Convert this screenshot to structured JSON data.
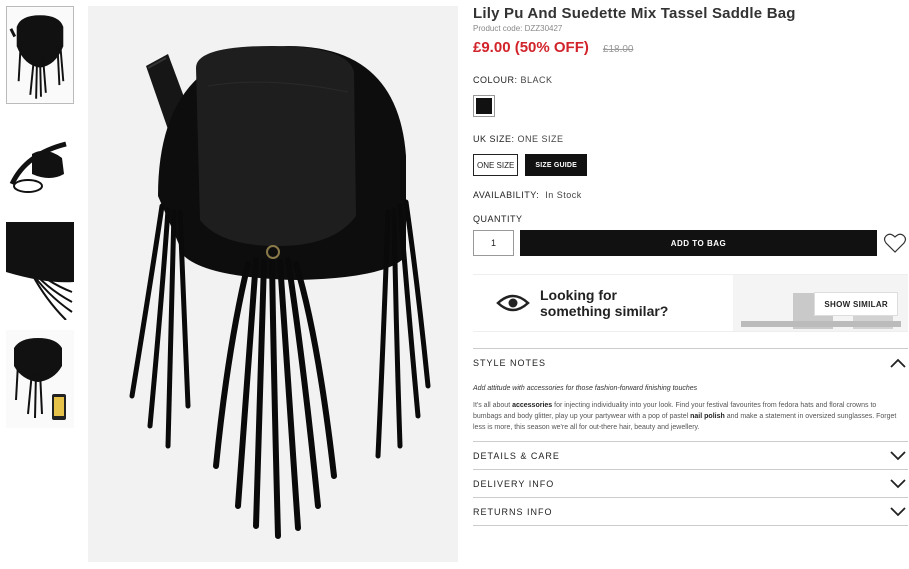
{
  "product": {
    "title": "Lily Pu And Suedette Mix Tassel Saddle Bag",
    "code": "Product code: DZZ30427",
    "price": "£9.00 (50% OFF)",
    "was_price": "£18.00"
  },
  "colour": {
    "label": "COLOUR:",
    "value": "BLACK",
    "swatch_color": "#111111"
  },
  "size": {
    "label": "UK SIZE:",
    "value": "ONE SIZE",
    "option": "ONE SIZE",
    "guide": "SIZE GUIDE"
  },
  "availability": {
    "label": "AVAILABILITY:",
    "value": "In Stock"
  },
  "quantity": {
    "label": "QUANTITY",
    "value": "1"
  },
  "cart": {
    "add_label": "ADD TO BAG"
  },
  "similar": {
    "line1": "Looking for",
    "line2": "something similar?",
    "button": "SHOW SIMILAR"
  },
  "style_notes": {
    "heading": "STYLE NOTES",
    "tagline": "Add attitude with accessories for those fashion-forward finishing touches",
    "p_a": "It's all about ",
    "b1": "accessories",
    "p_b": " for injecting individuality into your look. Find your festival favourites from fedora hats and floral crowns to bumbags and body glitter, play up your partywear with a pop of pastel ",
    "b2": "nail polish",
    "p_c": " and make a statement in oversized sunglasses. Forget less is more, this season we're all for out-there hair, beauty and jewellery."
  },
  "accordion": [
    {
      "label": "DETAILS & CARE"
    },
    {
      "label": "DELIVERY INFO"
    },
    {
      "label": "RETURNS INFO"
    }
  ],
  "icons": [
    "heart-icon",
    "eye-icon",
    "chevron-up-icon",
    "chevron-down-icon"
  ],
  "colors": {
    "sale": "#d2232a",
    "button": "#111111"
  }
}
